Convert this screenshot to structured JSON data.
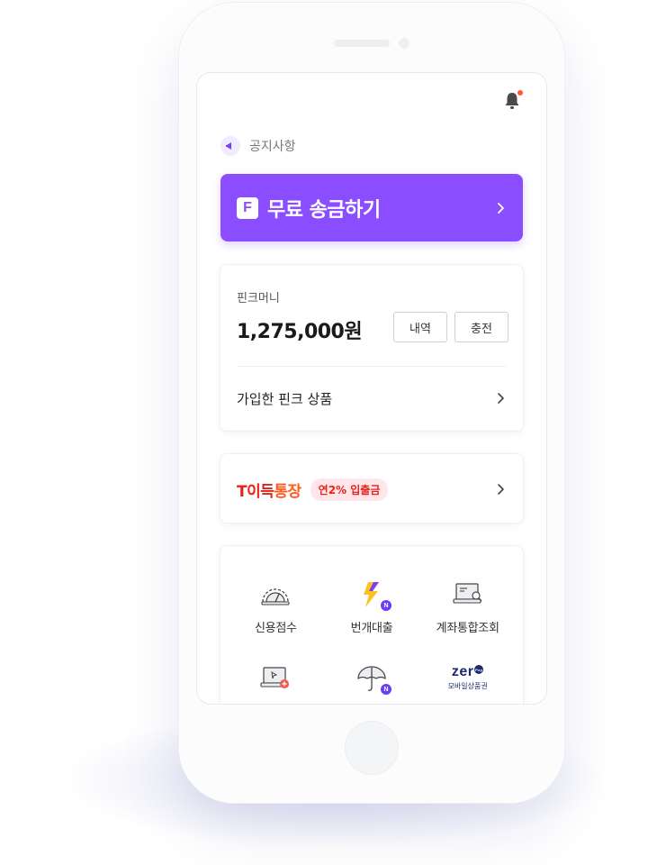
{
  "notice": {
    "label": "공지사항",
    "icon": "megaphone-icon"
  },
  "transfer": {
    "logo_letter": "F",
    "label": "무료 송금하기",
    "color": "#8a4dff"
  },
  "money": {
    "label": "핀크머니",
    "amount": "1,275,000원",
    "history_label": "내역",
    "charge_label": "충전",
    "joined_products_label": "가입한 핀크 상품"
  },
  "promo": {
    "title_part1": "T이득",
    "title_part2": "통장",
    "badge": "연2% 입출금"
  },
  "menu": {
    "items": [
      {
        "label": "신용점수",
        "icon": "gauge-icon"
      },
      {
        "label": "번개대출",
        "icon": "lightning-icon",
        "badge": "N"
      },
      {
        "label": "계좌통합조회",
        "icon": "laptop-search-icon"
      },
      {
        "label": "",
        "icon": "laptop-plus-icon"
      },
      {
        "label": "",
        "icon": "umbrella-icon",
        "badge": "N"
      },
      {
        "label": "",
        "icon": "zero-pay-logo",
        "logo_word": "zer",
        "logo_pay": "Pay",
        "logo_sub": "모바일상품권"
      }
    ]
  },
  "colors": {
    "accent": "#8a4dff",
    "alert": "#ff5a2c",
    "promo_red": "#e8221b"
  }
}
